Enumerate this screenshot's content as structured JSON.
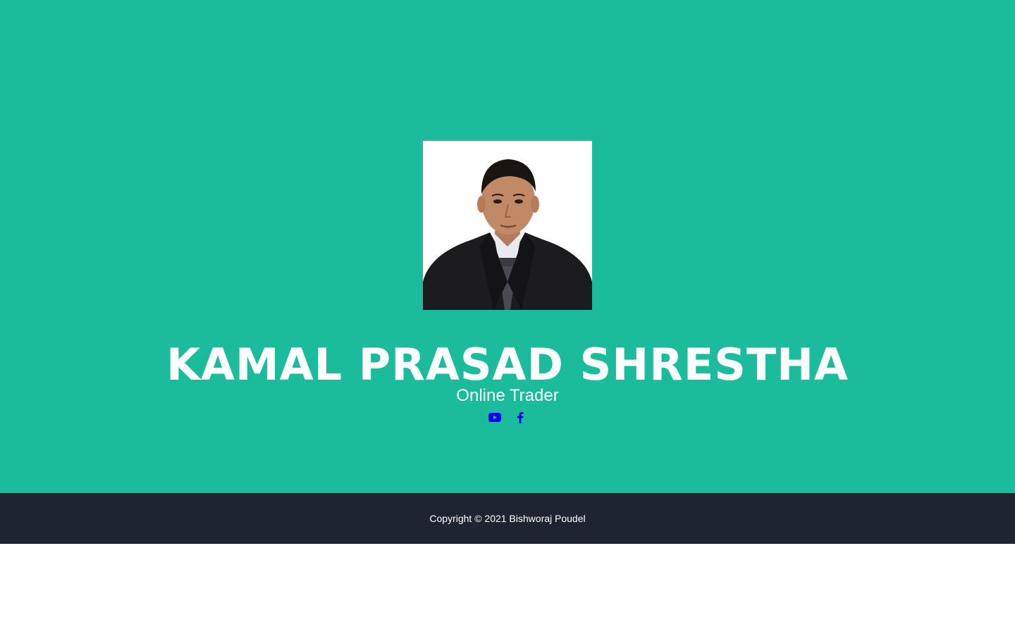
{
  "profile": {
    "name": "KAMAL PRASAD SHRESTHA",
    "title": "Online Trader"
  },
  "social": [
    {
      "icon": "youtube-icon"
    },
    {
      "icon": "facebook-icon"
    }
  ],
  "footer": {
    "copyright": "Copyright © 2021 Bishworaj Poudel"
  },
  "colors": {
    "hero_background": "#1abc9c",
    "footer_background": "#1e2530",
    "social_icon": "#0000ee",
    "text": "#ffffff"
  }
}
